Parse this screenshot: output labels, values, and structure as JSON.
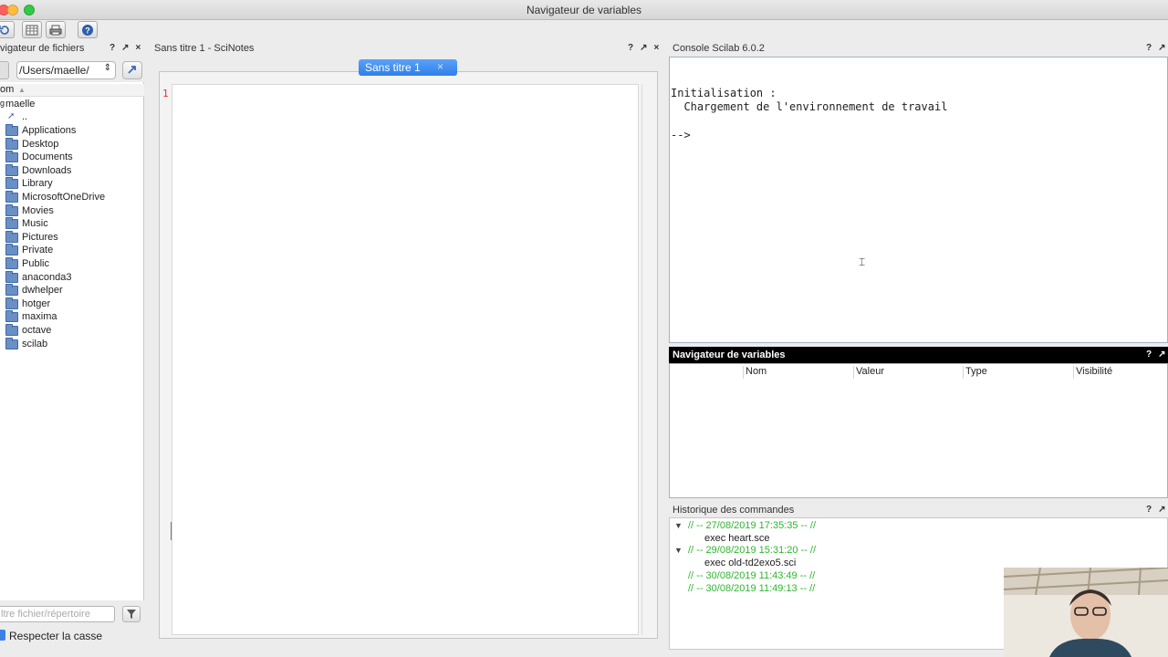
{
  "window": {
    "title": "Navigateur de variables"
  },
  "colors": {
    "history_green": "#2eb62e",
    "line_number_red": "#e53232",
    "tab_blue": "#2f7fe9"
  },
  "toolbar": {
    "icons": [
      "refresh-icon",
      "table-icon",
      "print-icon",
      "help-icon"
    ]
  },
  "file_browser": {
    "title": "vigateur de fichiers",
    "path": "/Users/maelle/",
    "column_header": "om",
    "root": "maelle",
    "parent": "..",
    "folders": [
      "Applications",
      "Desktop",
      "Documents",
      "Downloads",
      "Library",
      "MicrosoftOneDrive",
      "Movies",
      "Music",
      "Pictures",
      "Private",
      "Public",
      "anaconda3",
      "dwhelper",
      "hotger",
      "maxima",
      "octave",
      "scilab"
    ],
    "filter_placeholder": "ltre fichier/répertoire",
    "case_label": "Respecter la casse"
  },
  "scinotes": {
    "title": "Sans titre 1 - SciNotes",
    "tab_label": "Sans titre 1",
    "line_number": "1"
  },
  "console": {
    "title": "Console Scilab 6.0.2",
    "lines": [
      "Initialisation :",
      "  Chargement de l'environnement de travail",
      "",
      "-->"
    ]
  },
  "variables": {
    "title": "Navigateur de variables",
    "columns": [
      "Nom",
      "Valeur",
      "Type",
      "Visibilité"
    ]
  },
  "history": {
    "title": "Historique des commandes",
    "entries": [
      {
        "date": "// -- 27/08/2019 17:35:35 -- //",
        "command": "exec heart.sce"
      },
      {
        "date": "// -- 29/08/2019 15:31:20 -- //",
        "command": "exec old-td2exo5.sci"
      },
      {
        "date": "// -- 30/08/2019 11:43:49 -- //"
      },
      {
        "date": "// -- 30/08/2019 11:49:13 -- //"
      }
    ]
  },
  "panel_controls": {
    "help": "?",
    "undock": "↗",
    "close": "×"
  }
}
